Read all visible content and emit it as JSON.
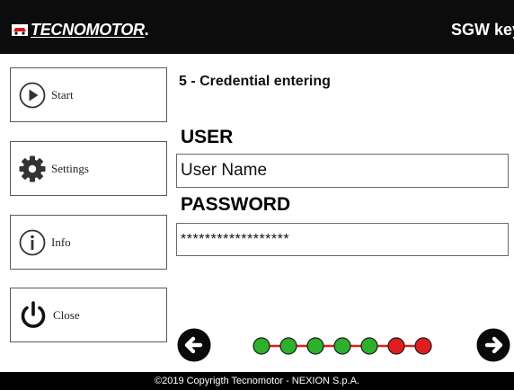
{
  "header": {
    "brand": "TECNOMOTOR",
    "brand_suffix": ".",
    "title": "SGW key"
  },
  "sidebar": {
    "items": [
      {
        "label": "Start",
        "icon": "play-icon"
      },
      {
        "label": "Settings",
        "icon": "gear-icon"
      },
      {
        "label": "Info",
        "icon": "info-icon"
      },
      {
        "label": "Close",
        "icon": "power-icon"
      }
    ]
  },
  "main": {
    "step_title": "5 - Credential entering",
    "user_label": "USER",
    "user_value": "User Name",
    "password_label": "PASSWORD",
    "password_value": "******************"
  },
  "progress": {
    "total_steps": 7,
    "completed_steps": 5,
    "colors": {
      "done": "#2db12d",
      "pending": "#e01e1e",
      "line": "#e01e1e"
    }
  },
  "footer": {
    "copyright": "©2019 Copyrigth Tecnomotor - NEXION S.p.A."
  }
}
